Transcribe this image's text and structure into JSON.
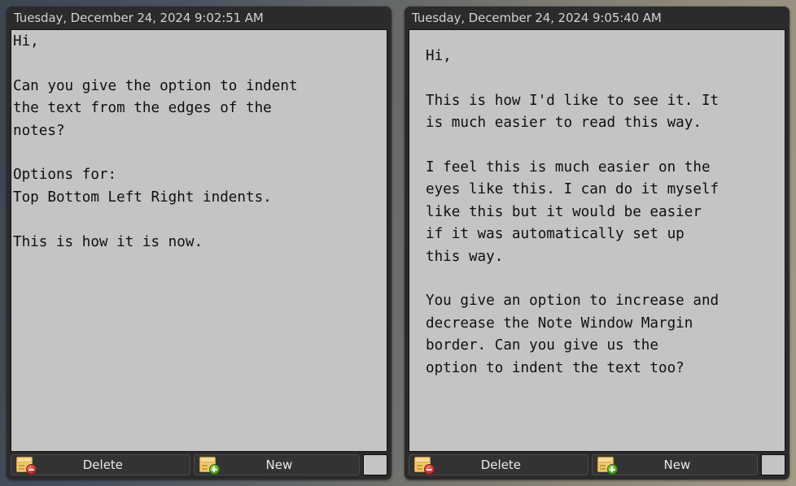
{
  "desktop": {
    "background_left_color": "#3c4652",
    "background_right_color": "#a49a88"
  },
  "notes": [
    {
      "id": "note-left",
      "title": "Tuesday, December 24, 2024 9:02:51 AM",
      "body": "Hi,\n\nCan you give the option to indent\nthe text from the edges of the\nnotes?\n\nOptions for:\nTop Bottom Left Right indents.\n\nThis is how it is now.",
      "indent_style": "none",
      "toolbar": {
        "delete_label": "Delete",
        "delete_icon": "note-minus-icon",
        "new_label": "New",
        "new_icon": "note-plus-icon",
        "color_swatch": "#c4c4c4"
      }
    },
    {
      "id": "note-right",
      "title": "Tuesday, December 24, 2024 9:05:40 AM",
      "body": "Hi,\n\nThis is how I'd like to see it. It\nis much easier to read this way.\n\nI feel this is much easier on the\neyes like this. I can do it myself\nlike this but it would be easier\nif it was automatically set up\nthis way.\n\nYou give an option to increase and\ndecrease the Note Window Margin\nborder. Can you give us the\noption to indent the text too?",
      "indent_style": "indent",
      "toolbar": {
        "delete_label": "Delete",
        "delete_icon": "note-minus-icon",
        "new_label": "New",
        "new_icon": "note-plus-icon",
        "color_swatch": "#c4c4c4"
      }
    }
  ]
}
